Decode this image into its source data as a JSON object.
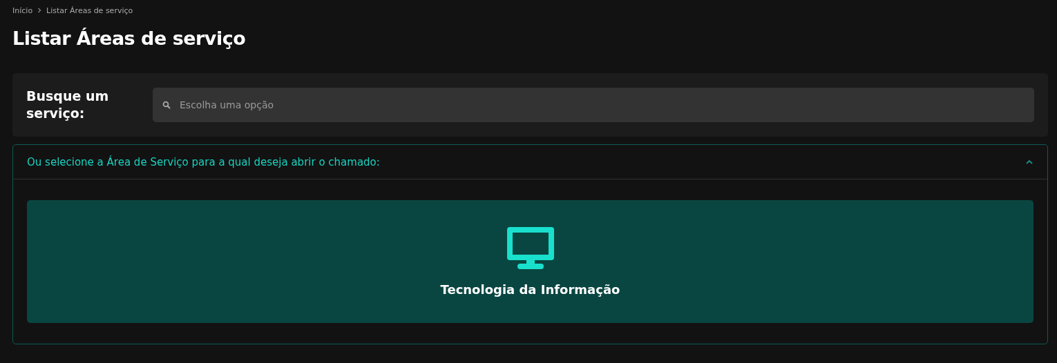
{
  "breadcrumb": [
    {
      "label": "Início"
    },
    {
      "label": "Listar Áreas de serviço"
    }
  ],
  "title": "Listar Áreas de serviço",
  "search": {
    "label": "Busque um serviço:",
    "placeholder": "Escolha uma opção"
  },
  "accordion": {
    "title": "Ou selecione a Área de Serviço para a qual deseja abrir o chamado:",
    "expanded": true,
    "areas": [
      {
        "label": "Tecnologia da Informação",
        "kind": "monitor"
      }
    ]
  }
}
